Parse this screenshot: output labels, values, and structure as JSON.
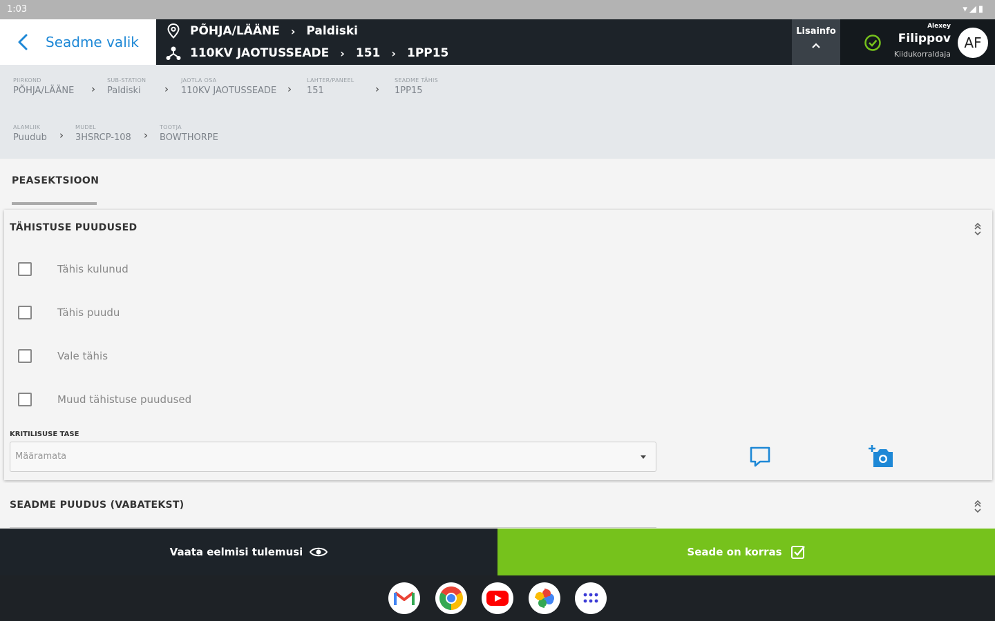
{
  "status_bar": {
    "time": "1:03",
    "icons": "▾◢▮"
  },
  "header": {
    "back_label": "Seadme valik",
    "location_crumbs": [
      "PÕHJA/LÄÄNE",
      "Paldiski"
    ],
    "device_crumbs": [
      "110KV JAOTUSSEADE",
      "151",
      "1PP15"
    ],
    "lisainfo_label": "Lisainfo",
    "user": {
      "role_top": "Alexey",
      "name": "Filippov",
      "role": "Kiidukorraldaja",
      "initials": "AF"
    }
  },
  "info": {
    "row1": [
      {
        "label": "PIIRKOND",
        "value": "PÕHJA/LÄÄNE"
      },
      {
        "label": "SUB-STATION",
        "value": "Paldiski"
      },
      {
        "label": "JAOTLA OSA",
        "value": "110KV JAOTUSSEADE"
      },
      {
        "label": "LAHTER/PANEEL",
        "value": "151"
      },
      {
        "label": "SEADME TÄHIS",
        "value": "1PP15"
      }
    ],
    "row2": [
      {
        "label": "ALAMLIIK",
        "value": "Puudub"
      },
      {
        "label": "MUDEL",
        "value": "3HSRCP-108"
      },
      {
        "label": "TOOTJA",
        "value": "BOWTHORPE"
      }
    ]
  },
  "tabs": {
    "main": "PEASEKTSIOON"
  },
  "section1": {
    "title": "TÄHISTUSE PUUDUSED",
    "checkboxes": [
      "Tähis kulunud",
      "Tähis puudu",
      "Vale tähis",
      "Muud tähistuse puudused"
    ],
    "criticality_label": "KRITILISUSE TASE",
    "criticality_value": "Määramata"
  },
  "section2": {
    "title": "SEADME PUUDUS (VABATEKST)"
  },
  "actions": {
    "previous_results": "Vaata eelmisi tulemusi",
    "device_ok": "Seade on korras"
  },
  "dock_apps": [
    "gmail-icon",
    "chrome-icon",
    "youtube-icon",
    "photos-icon",
    "app-drawer-icon"
  ],
  "colors": {
    "accent_blue": "#1e88d6",
    "green": "#76c21c",
    "dark": "#1d2329"
  }
}
